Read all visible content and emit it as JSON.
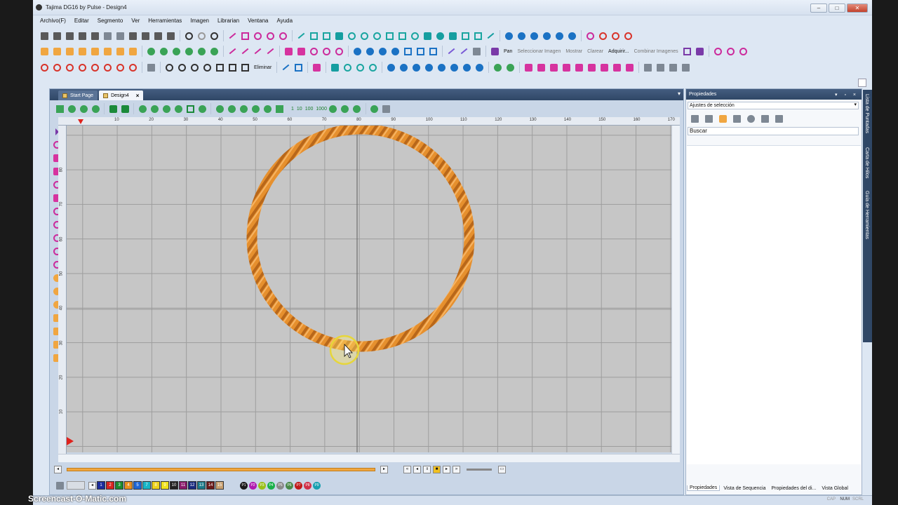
{
  "window": {
    "title": "Tajima DG16 by Pulse - Design4"
  },
  "menu": [
    "Archivo(F)",
    "Editar",
    "Segmento",
    "Ver",
    "Herramientas",
    "Imagen",
    "Librarian",
    "Ventana",
    "Ayuda"
  ],
  "toolbar": {
    "delete_label": "Eliminar",
    "pan_label": "Pan",
    "select_image_label": "Seleccionar Imagen",
    "show_label": "Mostrar",
    "clear_label": "Clarear",
    "acquire_label": "Adquirir...",
    "combine_label": "Combinar Imagenes"
  },
  "document_tabs": [
    {
      "label": "Start Page",
      "active": false
    },
    {
      "label": "Design4",
      "active": true
    }
  ],
  "ruler": {
    "top": [
      "10",
      "20",
      "30",
      "40",
      "50",
      "60",
      "70",
      "80",
      "90",
      "100",
      "110",
      "120",
      "130",
      "140",
      "150",
      "160",
      "170"
    ],
    "left": [
      "80",
      "70",
      "60",
      "50",
      "40",
      "30",
      "20",
      "10"
    ]
  },
  "design": {
    "shape": "circle",
    "fill": "rope stitch",
    "color": "#e6902e"
  },
  "stitch_colors": [
    {
      "label": "1",
      "color": "#1b2c9c"
    },
    {
      "label": "2",
      "color": "#d8241f"
    },
    {
      "label": "3",
      "color": "#1a8a2e"
    },
    {
      "label": "4",
      "color": "#e8901e"
    },
    {
      "label": "5",
      "color": "#1e66d6"
    },
    {
      "label": "7",
      "color": "#18b5c6"
    },
    {
      "label": "8",
      "color": "#f0d21c"
    },
    {
      "label": "9",
      "color": "#f0e21c"
    },
    {
      "label": "10",
      "color": "#222222"
    },
    {
      "label": "11",
      "color": "#8a1a6a"
    },
    {
      "label": "12",
      "color": "#1a2a80"
    },
    {
      "label": "13",
      "color": "#1a7a8a"
    },
    {
      "label": "14",
      "color": "#6a1a1a"
    },
    {
      "label": "15",
      "color": "#c8a070"
    }
  ],
  "palette_marks": [
    {
      "label": "P1",
      "color": "#1a1a1a"
    },
    {
      "label": "P2",
      "color": "#b01ab0"
    },
    {
      "label": "P3",
      "color": "#9ac01a"
    },
    {
      "label": "P4",
      "color": "#1ab04a"
    },
    {
      "label": "P5",
      "color": "#8a8a8a"
    },
    {
      "label": "P6",
      "color": "#4a8a4a"
    },
    {
      "label": "P7",
      "color": "#c01a1a"
    },
    {
      "label": "P8",
      "color": "#d0304a"
    },
    {
      "label": "P9",
      "color": "#18a0b0"
    }
  ],
  "properties": {
    "title": "Propiedades",
    "selection": "Ajustes de selección",
    "search_value": "Buscar",
    "bottom_tabs": [
      "Propiedades",
      "Vista de Sequencia",
      "Propiedades del di...",
      "Vista Global"
    ]
  },
  "side_tabs": [
    "Lista de Puntadas",
    "Carta de Hilos",
    "Guía de Herramientas"
  ],
  "status": {
    "cap": "CAP",
    "num": "NUM",
    "scrl": "SCRL"
  },
  "watermark": "Screencast-O-Matic.com"
}
